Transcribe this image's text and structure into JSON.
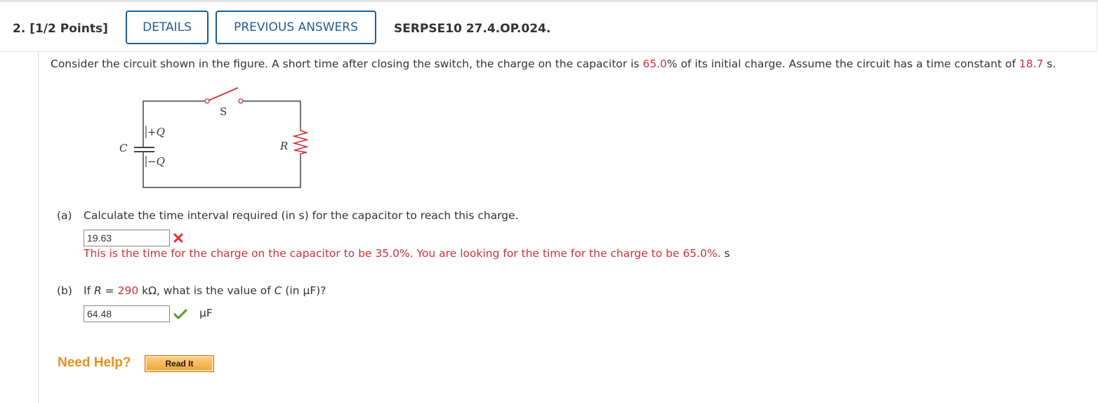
{
  "header": {
    "question_number": "2.",
    "points": "[1/2 Points]",
    "details_label": "DETAILS",
    "previous_answers_label": "PREVIOUS ANSWERS",
    "question_code": "SERPSE10 27.4.OP.024."
  },
  "prompt": {
    "text_1": "Consider the circuit shown in the figure. A short time after closing the switch, the charge on the capacitor is ",
    "charge_value": "65.0",
    "text_2": "% of its initial charge. Assume the circuit has a time constant of ",
    "time_constant": "18.7",
    "text_3": " s."
  },
  "figure": {
    "switch_label": "S",
    "capacitor_label": "C",
    "plus_q": "+Q",
    "minus_q": "−Q",
    "resistor_label": "R"
  },
  "part_a": {
    "label": "(a)",
    "question": "Calculate the time interval required (in s) for the capacitor to reach this charge.",
    "answer": "19.63",
    "status_icon": "x-mark-icon",
    "feedback": "This is the time for the charge on the capacitor to be 35.0%. You are looking for the time for the charge to be 65.0%.",
    "unit": "s"
  },
  "part_b": {
    "label": "(b)",
    "question_1": "If ",
    "question_var": "R",
    "question_eq": " = ",
    "resistance_value": "290",
    "question_2": " kΩ, what is the value of ",
    "question_var_c": "C",
    "question_3": " (in μF)?",
    "answer": "64.48",
    "status_icon": "check-mark-icon",
    "unit": "μF"
  },
  "help": {
    "need_help_label": "Need Help?",
    "read_it_label": "Read It"
  },
  "colors": {
    "button_blue": "#1e5c98",
    "given_value_red": "#c8323b",
    "correct_green": "#5aa02c",
    "help_orange": "#e7901e"
  }
}
